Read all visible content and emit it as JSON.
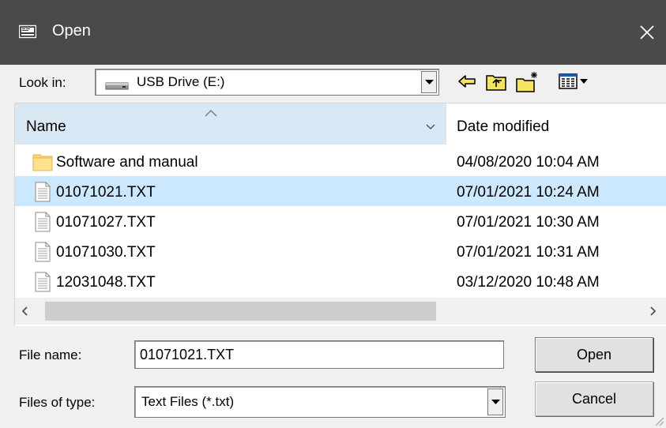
{
  "window": {
    "title": "Open",
    "app_icon": "open-dialog-icon",
    "close_icon": "close-icon"
  },
  "look_in": {
    "label": "Look in:",
    "value": "USB Drive (E:)",
    "icon": "usb-drive-icon"
  },
  "toolbar": {
    "buttons": [
      "back-arrow-icon",
      "up-one-level-icon",
      "new-folder-icon",
      "view-menu-icon"
    ]
  },
  "columns": {
    "name": "Name",
    "date": "Date modified"
  },
  "files": [
    {
      "name": "Software and manual",
      "date": "04/08/2020 10:04 AM",
      "type": "folder",
      "selected": false
    },
    {
      "name": "01071021.TXT",
      "date": "07/01/2021 10:24 AM",
      "type": "text",
      "selected": true
    },
    {
      "name": "01071027.TXT",
      "date": "07/01/2021 10:30 AM",
      "type": "text",
      "selected": false
    },
    {
      "name": "01071030.TXT",
      "date": "07/01/2021 10:31 AM",
      "type": "text",
      "selected": false
    },
    {
      "name": "12031048.TXT",
      "date": "03/12/2020 10:48 AM",
      "type": "text",
      "selected": false
    }
  ],
  "file_name": {
    "label": "File name:",
    "value": "01071021.TXT"
  },
  "file_type": {
    "label": "Files of type:",
    "value": "Text Files (*.txt)"
  },
  "buttons": {
    "open": "Open",
    "cancel": "Cancel"
  },
  "colors": {
    "titlebar": "#4a4a4a",
    "selection": "#cce8ff",
    "sort_header": "#d9e8f5",
    "folder": "#ffd66b"
  }
}
